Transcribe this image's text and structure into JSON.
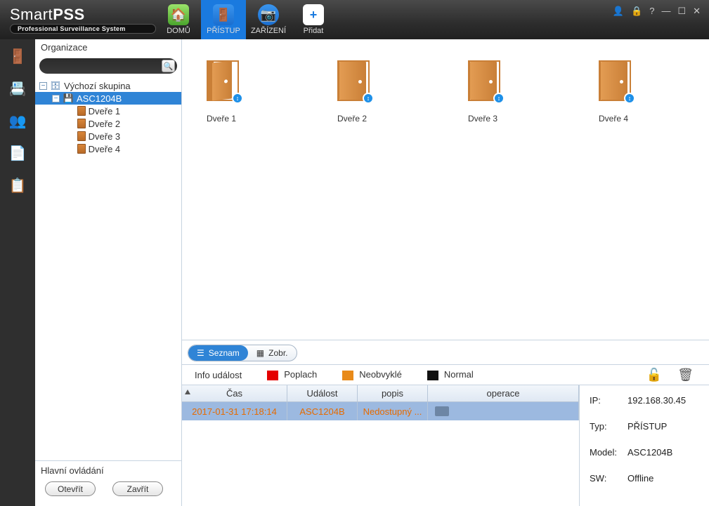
{
  "brand": {
    "name_light": "Smart",
    "name_bold": "PSS",
    "subtitle": "Professional Surveillance System"
  },
  "nav": {
    "home": "DOMŮ",
    "access": "PŘÍSTUP",
    "devices": "ZAŘÍZENÍ",
    "add": "Přidat"
  },
  "org": {
    "title": "Organizace",
    "root": "Výchozí skupina",
    "device": "ASC1204B",
    "doors": [
      "Dveře 1",
      "Dveře 2",
      "Dveře 3",
      "Dveře 4"
    ],
    "footer_label": "Hlavní ovládání",
    "open_btn": "Otevřít",
    "close_btn": "Zavřít"
  },
  "doors_view": [
    {
      "label": "Dveře 1",
      "open": true
    },
    {
      "label": "Dveře 2",
      "open": false
    },
    {
      "label": "Dveře 3",
      "open": false
    },
    {
      "label": "Dveře 4",
      "open": false
    }
  ],
  "toggle": {
    "list": "Seznam",
    "view": "Zobr."
  },
  "legend": {
    "info": "Info událost",
    "alarm": "Poplach",
    "unusual": "Neobvyklé",
    "normal": "Normal"
  },
  "grid": {
    "headers": {
      "time": "Čas",
      "event": "Událost",
      "desc": "popis",
      "op": "operace"
    },
    "row": {
      "time": "2017-01-31 17:18:14",
      "event": "ASC1204B",
      "desc": "Nedostupný ..."
    }
  },
  "details": {
    "ip_k": "IP:",
    "ip_v": "192.168.30.45",
    "type_k": "Typ:",
    "type_v": "PŘÍSTUP",
    "model_k": "Model:",
    "model_v": "ASC1204B",
    "sw_k": "SW:",
    "sw_v": "Offline"
  }
}
